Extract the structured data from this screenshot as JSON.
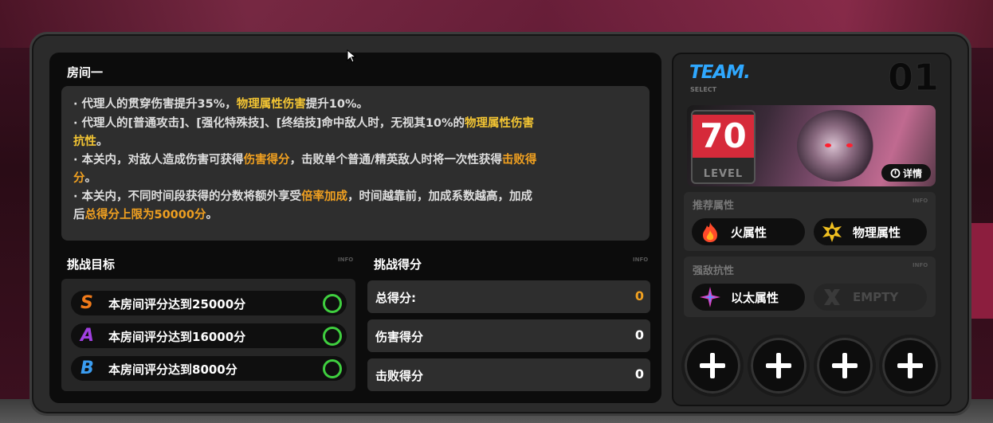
{
  "room": {
    "title": "房间一"
  },
  "description": {
    "line1": {
      "a": "· 代理人的贯穿伤害提升35%，",
      "b": "物理属性伤害",
      "c": "提升10%。"
    },
    "line2": {
      "a": "· 代理人的[普通攻击]、[强化特殊技]、[终结技]命中敌人时，无视其10%的",
      "b": "物理属性伤害"
    },
    "line3": {
      "a": "抗性",
      "b": "。"
    },
    "line4": {
      "a": "· 本关内，对敌人造成伤害可获得",
      "b": "伤害得分",
      "c": "，击败单个普通/精英敌人时将一次性获得",
      "d": "击败得"
    },
    "line5": {
      "a": "分",
      "b": "。"
    },
    "line6": {
      "a": "· 本关内，不同时间段获得的分数将额外享受",
      "b": "倍率加成",
      "c": "，时间越靠前，加成系数越高，加成"
    },
    "line7": {
      "a": "后",
      "b": "总得分上限为50000分",
      "c": "。"
    }
  },
  "goals": {
    "title": "挑战目标",
    "info": "INFO",
    "items": [
      {
        "rank": "S",
        "text": "本房间评分达到25000分",
        "color": "#f07a1a"
      },
      {
        "rank": "A",
        "text": "本房间评分达到16000分",
        "color": "#a040e0"
      },
      {
        "rank": "B",
        "text": "本房间评分达到8000分",
        "color": "#3a9cf0"
      }
    ]
  },
  "score": {
    "title": "挑战得分",
    "info": "INFO",
    "rows": [
      {
        "label": "总得分:",
        "value": "0",
        "color": "#f0a020"
      },
      {
        "label": "伤害得分",
        "value": "0",
        "color": "#ffffff"
      },
      {
        "label": "击败得分",
        "value": "0",
        "color": "#ffffff"
      }
    ]
  },
  "team": {
    "title": "TEAM.",
    "sub": "SELECT",
    "number": "01",
    "level": "70",
    "level_label": "LEVEL",
    "detail_label": "详情",
    "recommend_title": "推荐属性",
    "recommend_info": "INFO",
    "recommend": [
      {
        "label": "火属性",
        "icon": "fire-icon"
      },
      {
        "label": "物理属性",
        "icon": "physical-icon"
      }
    ],
    "resist_title": "强敌抗性",
    "resist_info": "INFO",
    "resist": [
      {
        "label": "以太属性",
        "icon": "ether-icon"
      },
      {
        "label": "EMPTY",
        "icon": "empty-x-icon"
      }
    ]
  }
}
